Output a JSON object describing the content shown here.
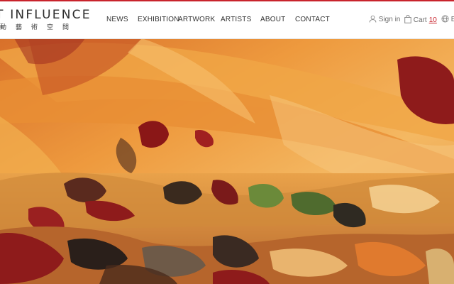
{
  "brand": {
    "name": "T INFLUENCE",
    "subtitle": "動藝術空間",
    "accent_color": "#c8232c"
  },
  "nav": {
    "items": [
      {
        "label": "NEWS"
      },
      {
        "label": "EXHIBITION"
      },
      {
        "label": "ARTWORK"
      },
      {
        "label": "ARTISTS"
      },
      {
        "label": "ABOUT"
      },
      {
        "label": "CONTACT"
      }
    ]
  },
  "utility": {
    "sign_in": {
      "icon": "user-icon",
      "label": "Sign in"
    },
    "cart": {
      "icon": "shopping-bag-icon",
      "label": "Cart",
      "count": "10"
    },
    "language": {
      "icon": "globe-icon",
      "label": "E"
    }
  },
  "hero": {
    "image": "abstract-painting",
    "palette": [
      "#e58a2c",
      "#f2b45c",
      "#8e1b1b",
      "#4a2a1c",
      "#6b8a3a",
      "#f7d79a"
    ]
  }
}
